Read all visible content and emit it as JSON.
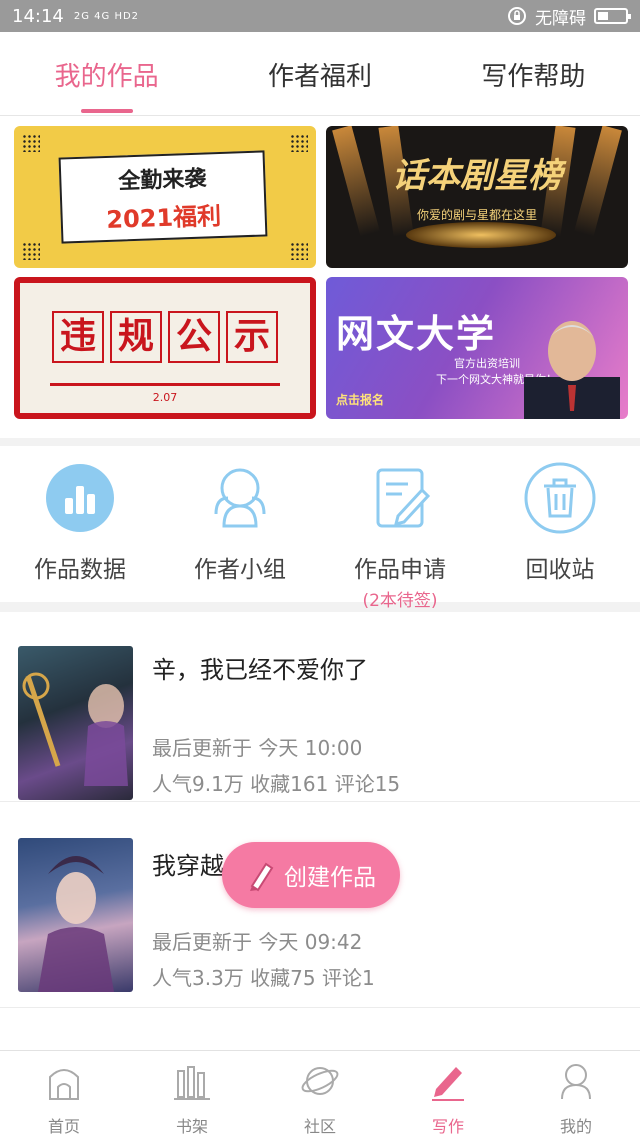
{
  "status_bar": {
    "time": "14:14",
    "signal": "2G 4G HD2",
    "network_label": "无障碍"
  },
  "tabs": [
    {
      "label": "我的作品"
    },
    {
      "label": "作者福利"
    },
    {
      "label": "写作帮助"
    }
  ],
  "banners": {
    "b1": {
      "line1": "全勤来袭",
      "line2": "2021福利"
    },
    "b2": {
      "title": "话本剧星榜",
      "subtitle": "你爱的剧与星都在这里"
    },
    "b3": {
      "chars": [
        "违",
        "规",
        "公",
        "示"
      ],
      "date": "2.07"
    },
    "b4": {
      "title": "网文大学",
      "line1": "官方出资培训",
      "line2": "下一个网文大神就是你！",
      "cta": "点击报名"
    }
  },
  "quick_actions": [
    {
      "label": "作品数据"
    },
    {
      "label": "作者小组"
    },
    {
      "label": "作品申请",
      "sub": "(2本待签)"
    },
    {
      "label": "回收站"
    }
  ],
  "works": [
    {
      "title": "辛，我已经不爱你了",
      "updated": "最后更新于 今天 10:00",
      "stats": "人气9.1万 收藏161 评论15"
    },
    {
      "title": "我穿越成了罗丽",
      "updated": "最后更新于 今天 09:42",
      "stats": "人气3.3万 收藏75 评论1"
    }
  ],
  "fab": {
    "label": "创建作品"
  },
  "bottom_nav": [
    {
      "label": "首页"
    },
    {
      "label": "书架"
    },
    {
      "label": "社区"
    },
    {
      "label": "写作"
    },
    {
      "label": "我的"
    }
  ],
  "colors": {
    "accent": "#e9668d",
    "fab": "#f57aa3",
    "icon_blue": "#8ecbf0"
  }
}
